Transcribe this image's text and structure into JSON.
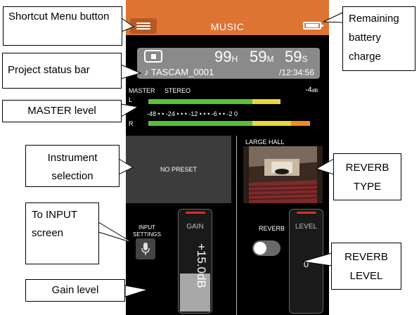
{
  "screen": {
    "title": "MUSIC",
    "status": {
      "hours": "99",
      "hours_unit": "H",
      "minutes": "59",
      "minutes_unit": "M",
      "seconds": "59",
      "seconds_unit": "S",
      "project_name": "♪ TASCAM_0001",
      "total_time": "/12:34:56"
    },
    "master": {
      "label": "MASTER",
      "mode": "STEREO",
      "level": "-4",
      "level_unit": "dB",
      "channel_l": "L",
      "channel_r": "R",
      "scale": "-48  •  •  -24  •  •  •  -12  •  •  •  -6  •  •  -2 0"
    },
    "preset": "NO PRESET",
    "reverb_type": "LARGE HALL",
    "input_settings": "INPUT SETTINGS",
    "gain_label": "GAIN",
    "gain_value": "+15.0dB",
    "gain_level": 0.38,
    "reverb_label": "REVERB",
    "reverb_on": false,
    "level_label": "LEVEL",
    "level_value": "0"
  },
  "colors": {
    "title_bar": "#dd7433",
    "meter_green": "#5bbf3b",
    "meter_yellow": "#e8d83a",
    "meter_orange": "#ef8a2c",
    "fader_red": "#d6302a"
  },
  "callouts": {
    "shortcut_menu": "Shortcut Menu button",
    "battery": "Remaining battery charge",
    "project_status": "Project status bar",
    "master_level": "MASTER level",
    "instrument": "Instrument selection",
    "reverb_type": "REVERB TYPE",
    "to_input": "To INPUT screen",
    "reverb_level": "REVERB LEVEL",
    "gain_level": "Gain level"
  }
}
